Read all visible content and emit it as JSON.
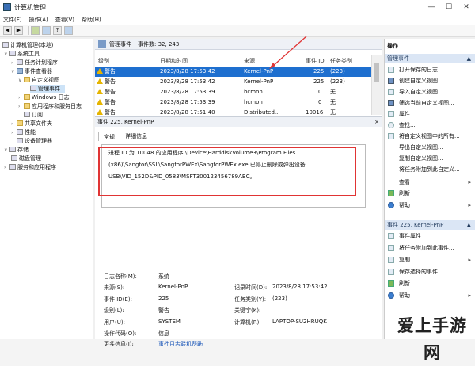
{
  "window": {
    "title": "计算机管理",
    "minimize": "—",
    "maximize": "☐",
    "close": "✕"
  },
  "menu": [
    "文件(F)",
    "操作(A)",
    "查看(V)",
    "帮助(H)"
  ],
  "tree": [
    "计算机管理(本地)",
    "系统工具",
    "任务计划程序",
    "事件查看器",
    "自定义视图",
    "管理事件",
    "Windows 日志",
    "应用程序和服务日志",
    "订阅",
    "共享文件夹",
    "性能",
    "设备管理器",
    "存储",
    "磁盘管理",
    "服务和应用程序"
  ],
  "event_list": {
    "title": "管理事件",
    "count_label": "事件数: 32, 243",
    "columns": [
      "级别",
      "日期和时间",
      "来源",
      "事件 ID",
      "任务类别"
    ],
    "rows": [
      {
        "level": "警告",
        "datetime": "2023/8/28 17:53:42",
        "source": "Kernel-PnP",
        "id": "225",
        "task": "(223)"
      },
      {
        "level": "警告",
        "datetime": "2023/8/28 17:53:42",
        "source": "Kernel-PnP",
        "id": "225",
        "task": "(223)"
      },
      {
        "level": "警告",
        "datetime": "2023/8/28 17:53:39",
        "source": "hcmon",
        "id": "0",
        "task": "无"
      },
      {
        "level": "警告",
        "datetime": "2023/8/28 17:53:39",
        "source": "hcmon",
        "id": "0",
        "task": "无"
      },
      {
        "level": "警告",
        "datetime": "2023/8/28 17:51:40",
        "source": "Distributed...",
        "id": "10016",
        "task": "无"
      }
    ]
  },
  "detail": {
    "header": "事件 225, Kernel-PnP",
    "close": "×",
    "tabs": [
      "常规",
      "详细信息"
    ],
    "message": "进程 ID 为 10048 的应用程序 \\Device\\HarddiskVolume3\\Program Files (x86)\\Sangfor\\SSL\\SangforPWEx\\SangforPWEx.exe 已停止删除或弹出设备 USB\\VID_152D&PID_0583\\MSFT300123456789ABC。",
    "labels": {
      "log_name": "日志名称(M):",
      "source": "来源(S):",
      "event_id": "事件 ID(E):",
      "level": "级别(L):",
      "user": "用户(U):",
      "opcode": "操作代码(O):",
      "more_info": "更多信息(I):",
      "logged": "记录时间(D):",
      "task": "任务类别(Y):",
      "keywords": "关键字(K):",
      "computer": "计算机(R):"
    },
    "values": {
      "log_name": "系统",
      "source": "Kernel-PnP",
      "event_id": "225",
      "level": "警告",
      "user": "SYSTEM",
      "opcode": "信息",
      "more_info": "事件日志联机帮助",
      "logged": "2023/8/28 17:53:42",
      "task": "(223)",
      "keywords": "",
      "computer": "LAPTOP-SU2HRUQK"
    }
  },
  "actions": {
    "title": "操作",
    "section1": "管理事件",
    "items1": [
      "打开保存的日志...",
      "创建自定义视图...",
      "导入自定义视图...",
      "筛选当前自定义视图...",
      "属性",
      "查找...",
      "将自定义视图中的所有...",
      "导出自定义视图...",
      "复制自定义视图...",
      "将任务附加到此自定义...",
      "查看",
      "刷新",
      "帮助"
    ],
    "section2": "事件 225, Kernel-PnP",
    "items2": [
      "事件属性",
      "将任务附加到此事件...",
      "复制",
      "保存选择的事件...",
      "刷新",
      "帮助"
    ]
  },
  "watermark": "爱上手游网"
}
